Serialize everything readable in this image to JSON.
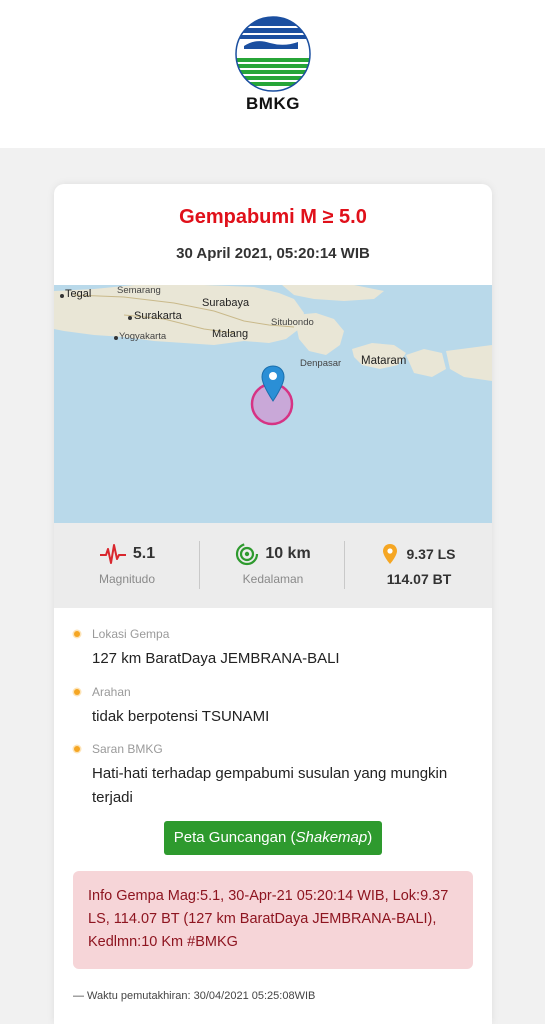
{
  "header": {
    "logo_text": "BMKG"
  },
  "card": {
    "title": "Gempabumi M ≥ 5.0",
    "datetime": "30 April 2021, 05:20:14 WIB"
  },
  "map": {
    "labels": {
      "tegal": "Tegal",
      "semarang": "Semarang",
      "surabaya": "Surabaya",
      "surakarta": "Surakarta",
      "yogyakarta": "Yogyakarta",
      "malang": "Malang",
      "situbondo": "Situbondo",
      "denpasar": "Denpasar",
      "mataram": "Mataram"
    },
    "colors": {
      "sea": "#b9d9ea",
      "land": "#e9e6d6",
      "epicenter": "#d63384",
      "pin": "#2a8fd6"
    }
  },
  "stats": {
    "magnitude": {
      "value": "5.1",
      "label": "Magnitudo",
      "icon": "seismograph-icon"
    },
    "depth": {
      "value": "10 km",
      "label": "Kedalaman",
      "icon": "epicenter-rings-icon"
    },
    "coords": {
      "lat": "9.37 LS",
      "lon": "114.07 BT",
      "icon": "location-pin-icon"
    }
  },
  "details": {
    "location": {
      "label": "Lokasi Gempa",
      "value": "127 km BaratDaya JEMBRANA-BALI"
    },
    "advice_direction": {
      "label": "Arahan",
      "value": "tidak berpotensi TSUNAMI"
    },
    "bmkg_advice": {
      "label": "Saran BMKG",
      "value": "Hati-hati terhadap gempabumi susulan yang mungkin terjadi"
    }
  },
  "shakemap_button": {
    "text": "Peta Guncangan (",
    "italic": "Shakemap",
    "close": ")"
  },
  "alert": {
    "text": "Info Gempa Mag:5.1, 30-Apr-21 05:20:14 WIB, Lok:9.37 LS, 114.07 BT (127 km BaratDaya JEMBRANA-BALI), Kedlmn:10 Km #BMKG"
  },
  "footer": {
    "text": "— Waktu pemutakhiran: 30/04/2021 05:25:08WIB"
  }
}
